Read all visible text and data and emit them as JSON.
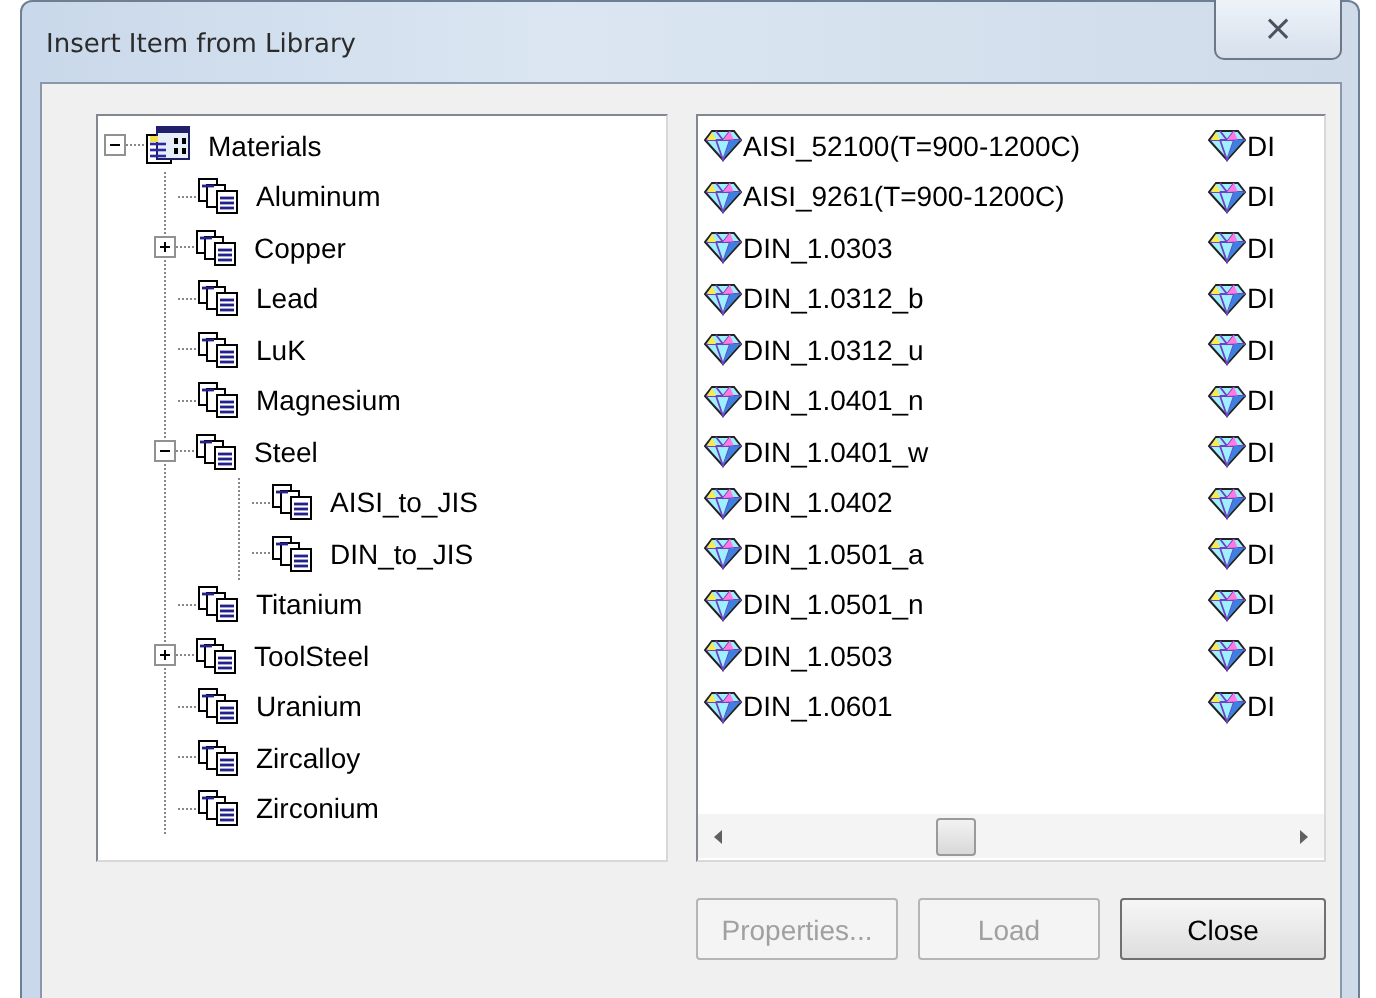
{
  "window": {
    "title": "Insert Item from Library",
    "close_button": "⨯"
  },
  "tree": [
    {
      "label": "Materials",
      "kind": "library",
      "expanded": true,
      "children": [
        {
          "label": "Aluminum",
          "kind": "folder"
        },
        {
          "label": "Copper",
          "kind": "folder",
          "expanded": false
        },
        {
          "label": "Lead",
          "kind": "folder"
        },
        {
          "label": "LuK",
          "kind": "folder"
        },
        {
          "label": "Magnesium",
          "kind": "folder"
        },
        {
          "label": "Steel",
          "kind": "folder",
          "expanded": true,
          "children": [
            {
              "label": "AISI_to_JIS",
              "kind": "folder"
            },
            {
              "label": "DIN_to_JIS",
              "kind": "folder"
            }
          ]
        },
        {
          "label": "Titanium",
          "kind": "folder"
        },
        {
          "label": "ToolSteel",
          "kind": "folder",
          "expanded": false
        },
        {
          "label": "Uranium",
          "kind": "folder"
        },
        {
          "label": "Zircalloy",
          "kind": "folder"
        },
        {
          "label": "Zirconium",
          "kind": "folder"
        }
      ]
    }
  ],
  "list": {
    "column_1": [
      "AISI_52100(T=900-1200C)",
      "AISI_9261(T=900-1200C)",
      "DIN_1.0303",
      "DIN_1.0312_b",
      "DIN_1.0312_u",
      "DIN_1.0401_n",
      "DIN_1.0401_w",
      "DIN_1.0402",
      "DIN_1.0501_a",
      "DIN_1.0501_n",
      "DIN_1.0503",
      "DIN_1.0601"
    ],
    "column_2": [
      "DI",
      "DI",
      "DI",
      "DI",
      "DI",
      "DI",
      "DI",
      "DI",
      "DI",
      "DI",
      "DI",
      "DI"
    ]
  },
  "buttons": [
    {
      "label": "Properties...",
      "disabled": true
    },
    {
      "label": "Load",
      "disabled": true
    },
    {
      "label": "Close",
      "disabled": false
    }
  ]
}
